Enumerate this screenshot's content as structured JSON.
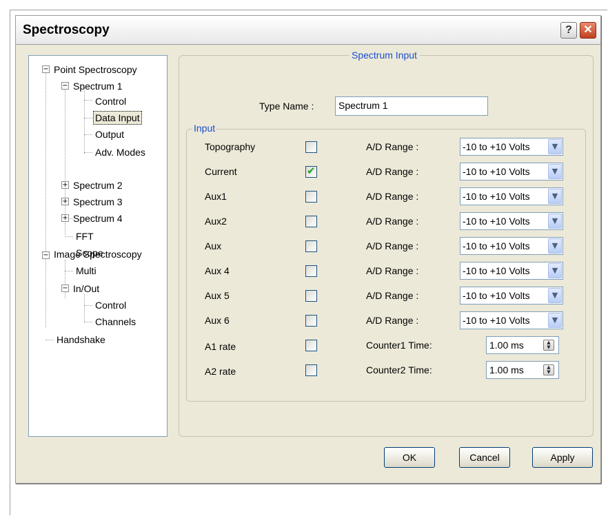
{
  "window": {
    "title": "Spectroscopy",
    "help_glyph": "?",
    "close_glyph": "✕"
  },
  "tree": {
    "items": [
      {
        "label": "Point Spectroscopy",
        "expander": "−"
      },
      {
        "label": "Spectrum  1",
        "expander": "−"
      },
      {
        "label": "Control"
      },
      {
        "label": "Data Input",
        "selected": true
      },
      {
        "label": "Output"
      },
      {
        "label": "Adv. Modes"
      },
      {
        "label": "Spectrum  2",
        "expander": "+"
      },
      {
        "label": "Spectrum  3",
        "expander": "+"
      },
      {
        "label": "Spectrum  4",
        "expander": "+"
      },
      {
        "label": "FFT"
      },
      {
        "label": "Scope"
      },
      {
        "label": "Image Spectroscopy",
        "expander": "−"
      },
      {
        "label": "Multi"
      },
      {
        "label": "In/Out",
        "expander": "−"
      },
      {
        "label": "Control"
      },
      {
        "label": "Channels"
      },
      {
        "label": "Handshake"
      }
    ]
  },
  "panel": {
    "caption": "Spectrum Input",
    "type_name_label": "Type Name :",
    "type_name_value": "Spectrum  1",
    "group_caption": "Input"
  },
  "rows": [
    {
      "label": "Topography",
      "checked": false,
      "range_label": "A/D Range :",
      "range_value": "-10 to +10 Volts"
    },
    {
      "label": "Current",
      "checked": true,
      "range_label": "A/D Range :",
      "range_value": "-10 to +10 Volts"
    },
    {
      "label": "Aux1",
      "checked": false,
      "range_label": "A/D Range :",
      "range_value": "-10 to +10 Volts"
    },
    {
      "label": "Aux2",
      "checked": false,
      "range_label": "A/D Range :",
      "range_value": "-10 to +10 Volts"
    },
    {
      "label": "Aux",
      "checked": false,
      "range_label": "A/D Range :",
      "range_value": "-10 to +10 Volts"
    },
    {
      "label": "Aux 4",
      "checked": false,
      "range_label": "A/D Range :",
      "range_value": "-10 to +10 Volts"
    },
    {
      "label": "Aux 5",
      "checked": false,
      "range_label": "A/D Range :",
      "range_value": "-10 to +10 Volts"
    },
    {
      "label": "Aux 6",
      "checked": false,
      "range_label": "A/D Range :",
      "range_value": "-10 to +10 Volts"
    }
  ],
  "rate_rows": [
    {
      "label": "A1 rate",
      "checked": false,
      "time_label": "Counter1 Time:",
      "time_value": "1.00 ms"
    },
    {
      "label": "A2 rate",
      "checked": false,
      "time_label": "Counter2 Time:",
      "time_value": "1.00 ms"
    }
  ],
  "buttons": {
    "ok": "OK",
    "cancel": "Cancel",
    "apply": "Apply"
  },
  "icons": {
    "dropdown": "chevron-down-icon",
    "spinner": "spin-arrows-icon",
    "check": "checkmark-icon"
  },
  "colors": {
    "caption_blue": "#1a4ecf",
    "check_green": "#21a121",
    "close_red": "#c0401e"
  }
}
